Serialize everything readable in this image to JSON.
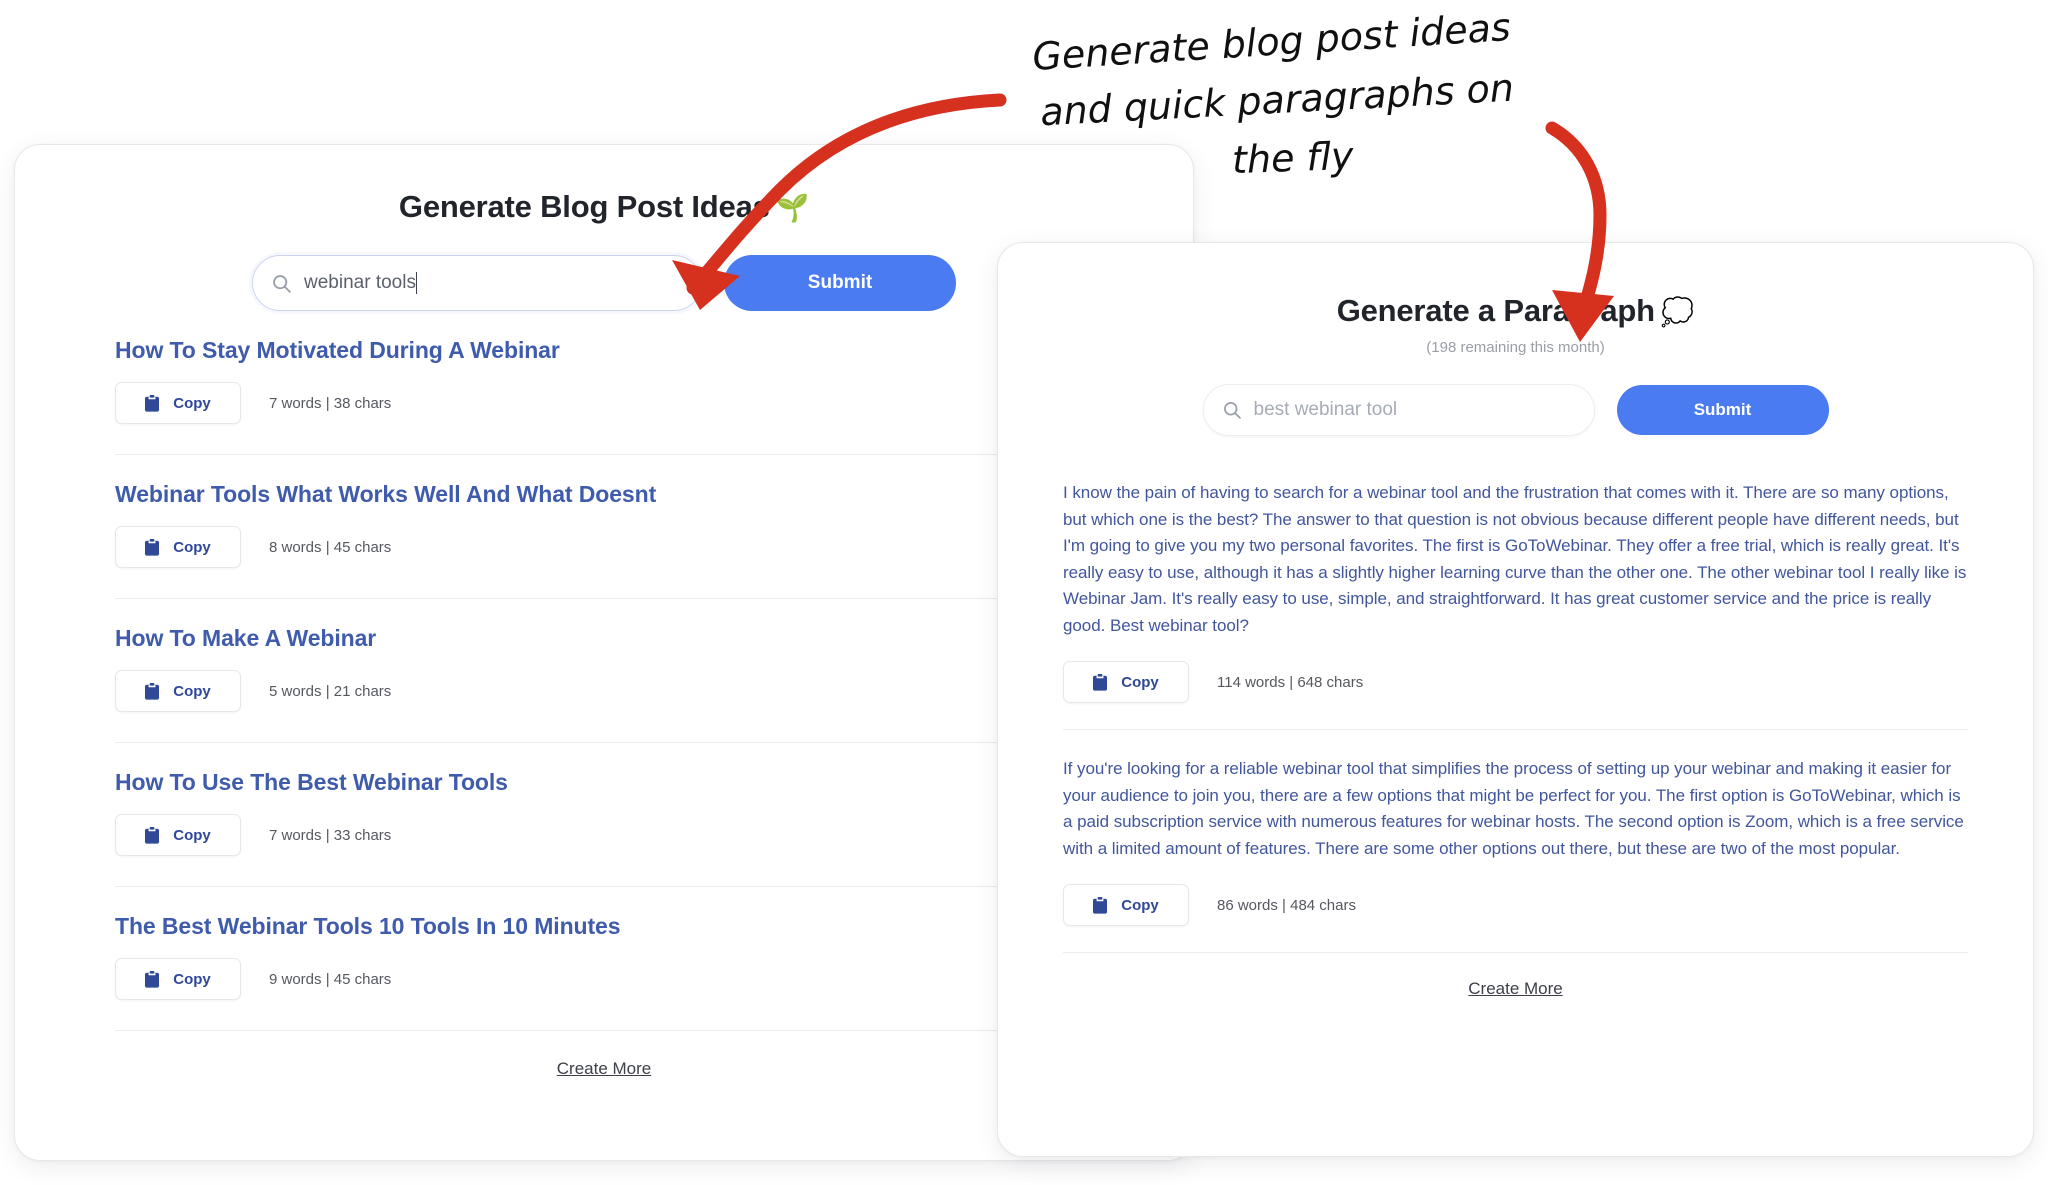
{
  "annotation": {
    "line1": "Generate blog post ideas",
    "line2": "and quick paragraphs on",
    "line3": "the fly",
    "arrow_color": "#d6301f"
  },
  "theme": {
    "accent_blue": "#4a7bf0",
    "link_blue": "#3f5bab",
    "paragraph_blue": "#41569c",
    "muted_gray": "#9b9ea6"
  },
  "left_panel": {
    "title": "Generate Blog Post Ideas",
    "title_emoji": "🌱",
    "search": {
      "icon": "search-icon",
      "value": "webinar tools",
      "placeholder": "webinar tools"
    },
    "submit_label": "Submit",
    "create_more_label": "Create More",
    "ideas": [
      {
        "title": "How To Stay Motivated During A Webinar",
        "copy_label": "Copy",
        "stats": "7 words | 38 chars"
      },
      {
        "title": "Webinar Tools What Works Well And What Doesnt",
        "copy_label": "Copy",
        "stats": "8 words | 45 chars"
      },
      {
        "title": "How To Make A Webinar",
        "copy_label": "Copy",
        "stats": "5 words | 21 chars"
      },
      {
        "title": "How To Use The Best Webinar Tools",
        "copy_label": "Copy",
        "stats": "7 words | 33 chars"
      },
      {
        "title": "The Best Webinar Tools 10 Tools In 10 Minutes",
        "copy_label": "Copy",
        "stats": "9 words | 45 chars"
      }
    ]
  },
  "right_panel": {
    "title": "Generate a Paragraph",
    "title_emoji": "💭",
    "subtitle": "(198 remaining this month)",
    "search": {
      "icon": "search-icon",
      "value": "best webinar tool",
      "placeholder": "best webinar tool"
    },
    "submit_label": "Submit",
    "create_more_label": "Create More",
    "paragraphs": [
      {
        "text": "I know the pain of having to search for a webinar tool and the frustration that comes with it. There are so many options, but which one is the best? The answer to that question is not obvious because different people have different needs, but I'm going to give you my two personal favorites. The first is GoToWebinar. They offer a free trial, which is really great. It's really easy to use, although it has a slightly higher learning curve than the other one. The other webinar tool I really like is Webinar Jam. It's really easy to use, simple, and straightforward. It has great customer service and the price is really good. Best webinar tool?",
        "copy_label": "Copy",
        "stats": "114 words | 648 chars"
      },
      {
        "text": "If you're looking for a reliable webinar tool that simplifies the process of setting up your webinar and making it easier for your audience to join you, there are a few options that might be perfect for you. The first option is GoToWebinar, which is a paid subscription service with numerous features for webinar hosts. The second option is Zoom, which is a free service with a limited amount of features. There are some other options out there, but these are two of the most popular.",
        "copy_label": "Copy",
        "stats": "86 words | 484 chars"
      }
    ]
  }
}
